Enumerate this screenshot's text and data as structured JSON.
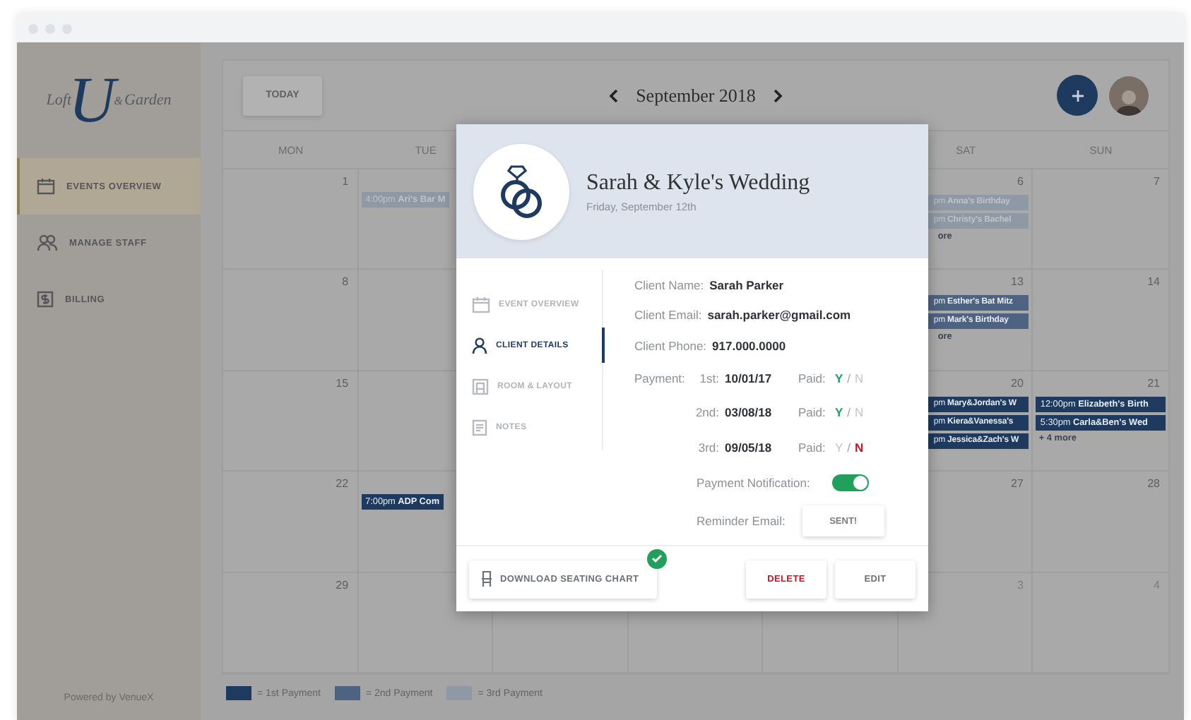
{
  "sidebar": {
    "logo": {
      "left": "Loft",
      "mark": "U",
      "amp": "&",
      "right": "Garden"
    },
    "items": [
      {
        "label": "EVENTS OVERVIEW",
        "selected": true
      },
      {
        "label": "MANAGE STAFF",
        "selected": false
      },
      {
        "label": "BILLING",
        "selected": false
      }
    ],
    "footer": "Powered by VenueX"
  },
  "calendar": {
    "today_button": "TODAY",
    "month": "September 2018",
    "weekdays": {
      "mon": "MON",
      "tue": "TUE",
      "sat": "SAT",
      "sun": "SUN"
    },
    "weeks": [
      {
        "mon": {
          "day": "1",
          "other_month": false
        },
        "tue": {
          "events": [
            {
              "text": "4:00pm **Ari's Bar M**",
              "color": "#8f99a6"
            }
          ]
        },
        "sat": {
          "day": "6",
          "other_month": false,
          "events": [
            {
              "text": "pm **Anna's Birthday**",
              "color": "#8f99a6"
            },
            {
              "text": "pm **Christy's Bachel**",
              "color": "#8f99a6"
            }
          ],
          "more": "ore"
        },
        "sun": {
          "day": "7",
          "other_month": false
        }
      },
      {
        "mon": {
          "day": "8",
          "other_month": false
        },
        "sat": {
          "day": "13",
          "other_month": false,
          "events": [
            {
              "text": "pm **Esther's Bat Mitz**",
              "color": "#4e6382"
            },
            {
              "text": "pm **Mark's Birthday**",
              "color": "#4e6382"
            }
          ],
          "more": "ore"
        },
        "sun": {
          "day": "14",
          "other_month": false
        }
      },
      {
        "mon": {
          "day": "15",
          "other_month": false
        },
        "sat": {
          "day": "20",
          "other_month": false,
          "events": [
            {
              "text": "pm **Mary&Jordan's W**",
              "color": "#1e3a5f"
            },
            {
              "text": "pm **Kiera&Vanessa's**",
              "color": "#1e3a5f"
            },
            {
              "text": "pm **Jessica&Zach's W**",
              "color": "#1e3a5f"
            }
          ]
        },
        "sun": {
          "day": "21",
          "other_month": false,
          "events": [
            {
              "text": "12:00pm **Elizabeth's Birth**",
              "color": "#1e3a5f"
            },
            {
              "text": "5:30pm **Carla&Ben's Wed**",
              "color": "#1e3a5f"
            }
          ],
          "more": "+ 4 more"
        }
      },
      {
        "mon": {
          "day": "22",
          "other_month": false
        },
        "tue": {
          "events": [
            {
              "text": "7:00pm **ADP Com**",
              "color": "#1e3a5f"
            }
          ]
        },
        "sat": {
          "day": "27",
          "other_month": false
        },
        "sun": {
          "day": "28",
          "other_month": false
        }
      },
      {
        "mon": {
          "day": "29",
          "other_month": false
        },
        "sat": {
          "day": "3",
          "other_month": true
        },
        "sun": {
          "day": "4",
          "other_month": true
        }
      }
    ],
    "legend": [
      {
        "label": "= 1st Payment",
        "color": "#1e3a5f"
      },
      {
        "label": "= 2nd Payment",
        "color": "#4e6382"
      },
      {
        "label": "= 3rd Payment",
        "color": "#8f99a6"
      }
    ]
  },
  "modal": {
    "title": "Sarah & Kyle's Wedding",
    "date": "Friday, September 12th",
    "nav": [
      {
        "label": "EVENT OVERVIEW",
        "selected": false
      },
      {
        "label": "CLIENT DETAILS",
        "selected": true
      },
      {
        "label": "ROOM & LAYOUT",
        "selected": false
      },
      {
        "label": "NOTES",
        "selected": false
      }
    ],
    "fields": [
      {
        "label": "Client Name:",
        "value": "Sarah Parker"
      },
      {
        "label": "Client Email:",
        "value": "sarah.parker@gmail.com"
      },
      {
        "label": "Client Phone:",
        "value": "917.000.0000"
      }
    ],
    "payment_label": "Payment:",
    "payments": [
      {
        "ordinal": "1st:",
        "date": "10/01/17",
        "paid_label": "Paid:",
        "yes": "Y",
        "separator": "/",
        "no": "N",
        "paid": true
      },
      {
        "ordinal": "2nd:",
        "date": "03/08/18",
        "paid_label": "Paid:",
        "yes": "Y",
        "separator": "/",
        "no": "N",
        "paid": true
      },
      {
        "ordinal": "3rd:",
        "date": "09/05/18",
        "paid_label": "Paid:",
        "yes": "Y",
        "separator": "/",
        "no": "N",
        "paid": false
      }
    ],
    "notification": {
      "label": "Payment Notification:",
      "on": true
    },
    "reminder": {
      "label": "Reminder Email:",
      "button": "SENT!"
    },
    "footer": {
      "download": "DOWNLOAD SEATING CHART",
      "downloaded": true,
      "delete": "DELETE",
      "edit": "EDIT"
    }
  }
}
